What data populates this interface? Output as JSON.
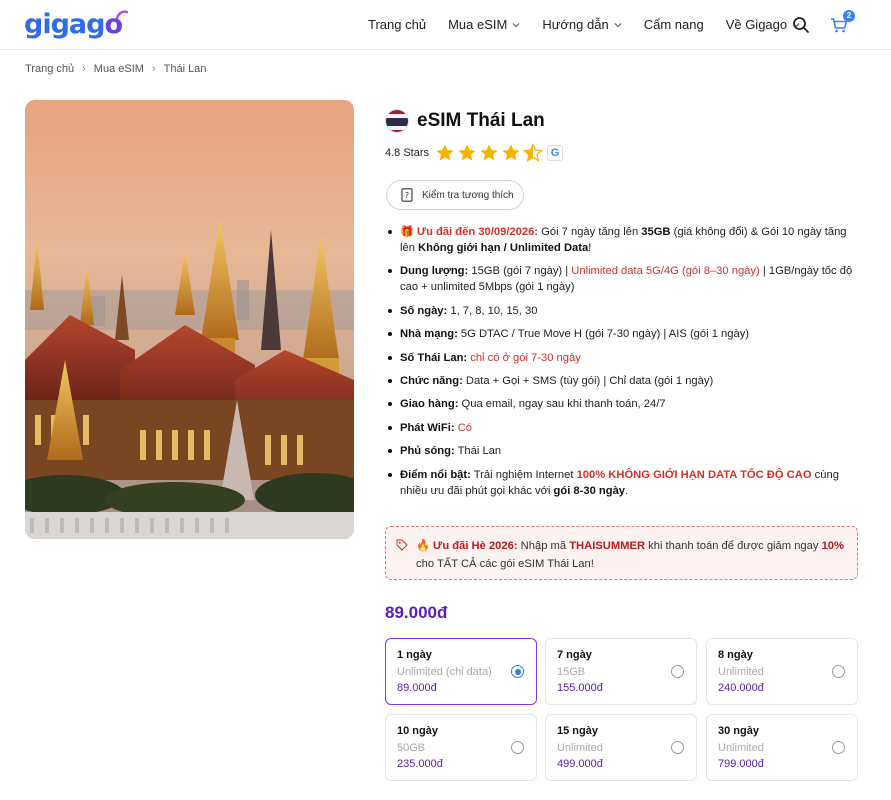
{
  "header": {
    "logo": "gigago",
    "nav": [
      {
        "label": "Trang chủ",
        "dropdown": false
      },
      {
        "label": "Mua eSIM",
        "dropdown": true
      },
      {
        "label": "Hướng dẫn",
        "dropdown": true
      },
      {
        "label": "Cẩm nang",
        "dropdown": false
      },
      {
        "label": "Về Gigago",
        "dropdown": true
      }
    ],
    "cart_count": "2",
    "icons": [
      "search-icon",
      "cart-icon"
    ]
  },
  "breadcrumb": [
    "Trang chủ",
    "Mua eSIM",
    "Thái Lan"
  ],
  "product": {
    "title": "eSIM Thái Lan",
    "rating_text": "4.8 Stars",
    "rating_value": 4.8,
    "compat_button": "Kiểm tra tương thích",
    "specs": {
      "offer_label": "Ưu đãi đến 30/09/2026:",
      "offer_t1": " Gói 7 ngày tăng lên ",
      "offer_b1": "35GB",
      "offer_t2": " (giá không đổi) & Gói 10 ngày tăng lên ",
      "offer_b2": "Không giới hạn / Unlimited Data",
      "offer_t3": "!",
      "capacity_label": "Dung lượng:",
      "capacity_t1": " 15GB (gói 7 ngày) | ",
      "capacity_red": "Unlimited data 5G/4G (gói 8–30 ngày)",
      "capacity_t2": " | 1GB/ngày tốc độ cao + unlimited 5Mbps (gói 1 ngày)",
      "days_label": "Số ngày:",
      "days_value": " 1, 7, 8, 10, 15, 30",
      "carrier_label": "Nhà mạng:",
      "carrier_value": " 5G DTAC / True Move H (gói 7-30 ngày) | AIS (gói 1 ngày)",
      "number_label": "Số Thái Lan:",
      "number_red": " chỉ có ở gói 7-30 ngày",
      "function_label": "Chức năng:",
      "function_value": " Data + Gọi + SMS (tùy gói) | Chỉ data (gói 1 ngày)",
      "delivery_label": "Giao hàng:",
      "delivery_value": " Qua email, ngay sau khi thanh toán, 24/7",
      "wifi_label": "Phát WiFi:",
      "wifi_red": " Có",
      "coverage_label": "Phủ sóng:",
      "coverage_value": " Thái Lan",
      "highlight_label": "Điểm nổi bật:",
      "highlight_t1": " Trải nghiệm Internet ",
      "highlight_red": "100% KHÔNG GIỚI HẠN DATA TỐC ĐỘ CAO",
      "highlight_t2": " cùng nhiều ưu đãi phút gọi khác với ",
      "highlight_b": "gói 8-30 ngày",
      "highlight_t3": "."
    },
    "promo": {
      "label": "Ưu đãi Hè 2026:",
      "t1": " Nhập mã ",
      "code": "THAISUMMER",
      "t2": " khi thanh toán để được giảm ngay ",
      "pct": "10%",
      "t3": " cho TẤT CẢ các gói eSIM Thái Lan!"
    },
    "price": "89.000đ",
    "plans": [
      {
        "name": "1 ngày",
        "data": "Unlimited (chỉ data)",
        "price": "89.000đ",
        "selected": true
      },
      {
        "name": "7 ngày",
        "data": "15GB",
        "price": "155.000đ",
        "selected": false
      },
      {
        "name": "8 ngày",
        "data": "Unlimited",
        "price": "240.000đ",
        "selected": false
      },
      {
        "name": "10 ngày",
        "data": "50GB",
        "price": "235.000đ",
        "selected": false
      },
      {
        "name": "15 ngày",
        "data": "Unlimited",
        "price": "499.000đ",
        "selected": false
      },
      {
        "name": "30 ngày",
        "data": "Unlimited",
        "price": "799.000đ",
        "selected": false
      }
    ]
  },
  "colors": {
    "brand_blue": "#2e6de8",
    "accent_purple": "#5b21b6",
    "highlight_red": "#d32f2f",
    "star": "#f4b400"
  }
}
